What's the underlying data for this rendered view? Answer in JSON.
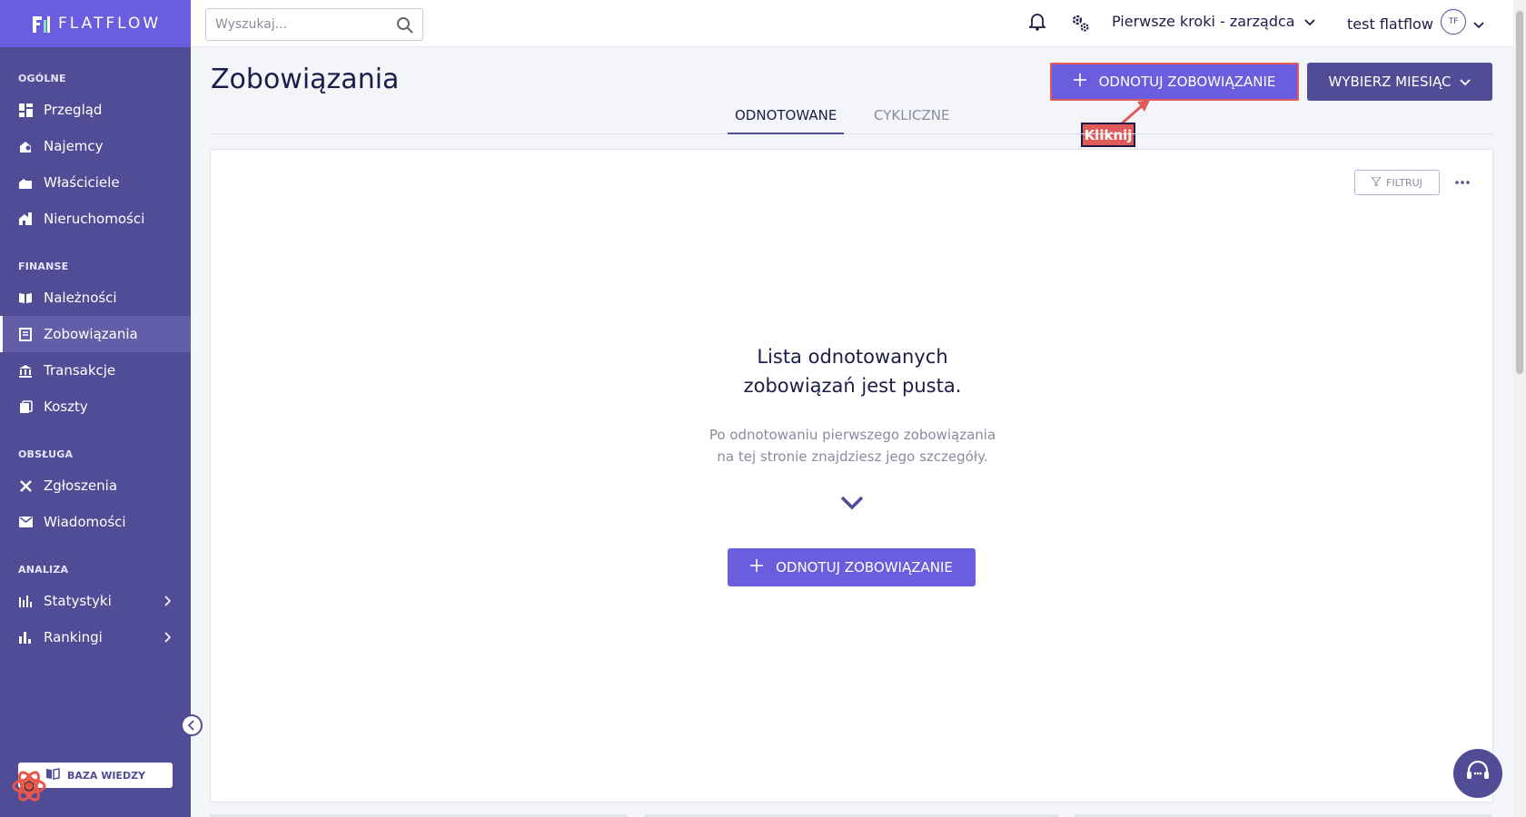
{
  "brand": {
    "name": "FLATFLOW"
  },
  "sidebar": {
    "sections": [
      {
        "title": "OGÓLNE",
        "items": [
          {
            "label": "Przegląd",
            "icon": "dashboard-icon"
          },
          {
            "label": "Najemcy",
            "icon": "tenants-icon"
          },
          {
            "label": "Właściciele",
            "icon": "owners-icon"
          },
          {
            "label": "Nieruchomości",
            "icon": "properties-icon"
          }
        ]
      },
      {
        "title": "FINANSE",
        "items": [
          {
            "label": "Należności",
            "icon": "receivables-icon"
          },
          {
            "label": "Zobowiązania",
            "icon": "liabilities-icon",
            "active": true
          },
          {
            "label": "Transakcje",
            "icon": "bank-icon"
          },
          {
            "label": "Koszty",
            "icon": "costs-icon"
          }
        ]
      },
      {
        "title": "OBSŁUGA",
        "items": [
          {
            "label": "Zgłoszenia",
            "icon": "tools-icon"
          },
          {
            "label": "Wiadomości",
            "icon": "mail-icon"
          }
        ]
      },
      {
        "title": "ANALIZA",
        "items": [
          {
            "label": "Statystyki",
            "icon": "stats-icon",
            "expandable": true
          },
          {
            "label": "Rankingi",
            "icon": "ranking-icon",
            "expandable": true
          }
        ]
      }
    ],
    "knowledge_base_label": "BAZA WIEDZY"
  },
  "topbar": {
    "search_placeholder": "Wyszukaj...",
    "company": "Pierwsze kroki - zarządca",
    "user_name": "test flatflow",
    "user_initials": "TF"
  },
  "page": {
    "title": "Zobowiązania",
    "add_button_label": "ODNOTUJ ZOBOWIĄZANIE",
    "month_button_label": "WYBIERZ MIESIĄC",
    "hint_label": "Kliknij",
    "tabs": [
      {
        "label": "ODNOTOWANE",
        "active": true
      },
      {
        "label": "CYKLICZNE",
        "active": false
      }
    ],
    "filter_label": "FILTRUJ",
    "empty_title_line1": "Lista odnotowanych",
    "empty_title_line2": "zobowiązań jest pusta.",
    "empty_desc_line1": "Po odnotowaniu pierwszego zobowiązania",
    "empty_desc_line2": "na tej stronie znajdziesz jego szczegóły.",
    "center_button_label": "ODNOTUJ ZOBOWIĄZANIE"
  },
  "colors": {
    "sidebar": "#504c96",
    "brand": "#6a5ede",
    "hint": "#e05a5a"
  }
}
